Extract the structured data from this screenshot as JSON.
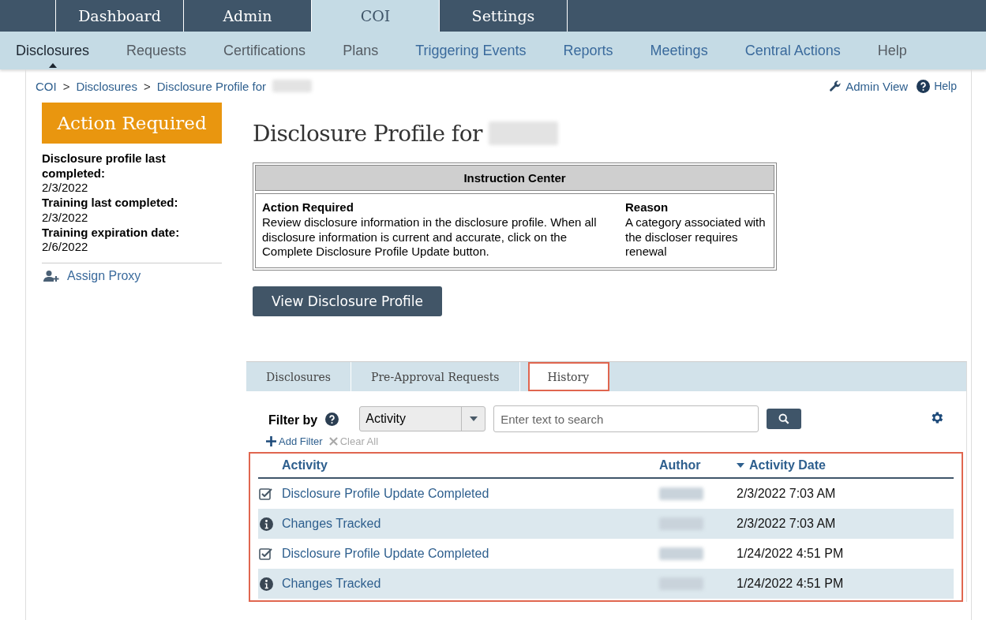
{
  "top_tabs": [
    {
      "label": "Dashboard",
      "selected": false
    },
    {
      "label": "Admin",
      "selected": false
    },
    {
      "label": "COI",
      "selected": true
    },
    {
      "label": "Settings",
      "selected": false
    }
  ],
  "sub_nav": [
    {
      "label": "Disclosures",
      "selected": true,
      "kind": "plain"
    },
    {
      "label": "Requests",
      "selected": false,
      "kind": "plain"
    },
    {
      "label": "Certifications",
      "selected": false,
      "kind": "plain"
    },
    {
      "label": "Plans",
      "selected": false,
      "kind": "plain"
    },
    {
      "label": "Triggering Events",
      "selected": false,
      "kind": "link"
    },
    {
      "label": "Reports",
      "selected": false,
      "kind": "link"
    },
    {
      "label": "Meetings",
      "selected": false,
      "kind": "link"
    },
    {
      "label": "Central Actions",
      "selected": false,
      "kind": "link"
    },
    {
      "label": "Help",
      "selected": false,
      "kind": "plain"
    }
  ],
  "breadcrumb": {
    "separator": ">",
    "items": [
      "COI",
      "Disclosures",
      "Disclosure Profile for"
    ]
  },
  "header_links": {
    "admin_view": "Admin View",
    "help": "Help"
  },
  "sidebar": {
    "status": "Action Required",
    "facts": [
      {
        "label": "Disclosure profile last completed:",
        "value": "2/3/2022"
      },
      {
        "label": "Training last completed:",
        "value": "2/3/2022"
      },
      {
        "label": "Training expiration date:",
        "value": "2/6/2022"
      }
    ],
    "assign_proxy": "Assign Proxy"
  },
  "title": "Disclosure Profile for",
  "instruction_center": {
    "title": "Instruction Center",
    "columns": [
      "Action Required",
      "Reason"
    ],
    "cells": [
      "Review disclosure information in the disclosure profile. When all disclosure information is current and accurate, click on the Complete Disclosure Profile Update button.",
      "A category associated with the discloser requires renewal"
    ]
  },
  "view_button": "View Disclosure Profile",
  "tabs": [
    {
      "label": "Disclosures",
      "selected": false,
      "highlighted": false
    },
    {
      "label": "Pre-Approval Requests",
      "selected": false,
      "highlighted": false
    },
    {
      "label": "History",
      "selected": true,
      "highlighted": true
    }
  ],
  "filter": {
    "label": "Filter by",
    "field": "Activity",
    "placeholder": "Enter text to search",
    "add_filter": "Add Filter",
    "clear_all": "Clear All"
  },
  "table": {
    "highlighted": true,
    "columns": [
      "Activity",
      "Author",
      "Activity Date"
    ],
    "rows": [
      {
        "kind": "check",
        "activity": "Disclosure Profile Update Completed",
        "date": "2/3/2022 7:03 AM"
      },
      {
        "kind": "info",
        "activity": "Changes Tracked",
        "date": "2/3/2022 7:03 AM"
      },
      {
        "kind": "check",
        "activity": "Disclosure Profile Update Completed",
        "date": "1/24/2022 4:51 PM"
      },
      {
        "kind": "info",
        "activity": "Changes Tracked",
        "date": "1/24/2022 4:51 PM"
      }
    ]
  }
}
